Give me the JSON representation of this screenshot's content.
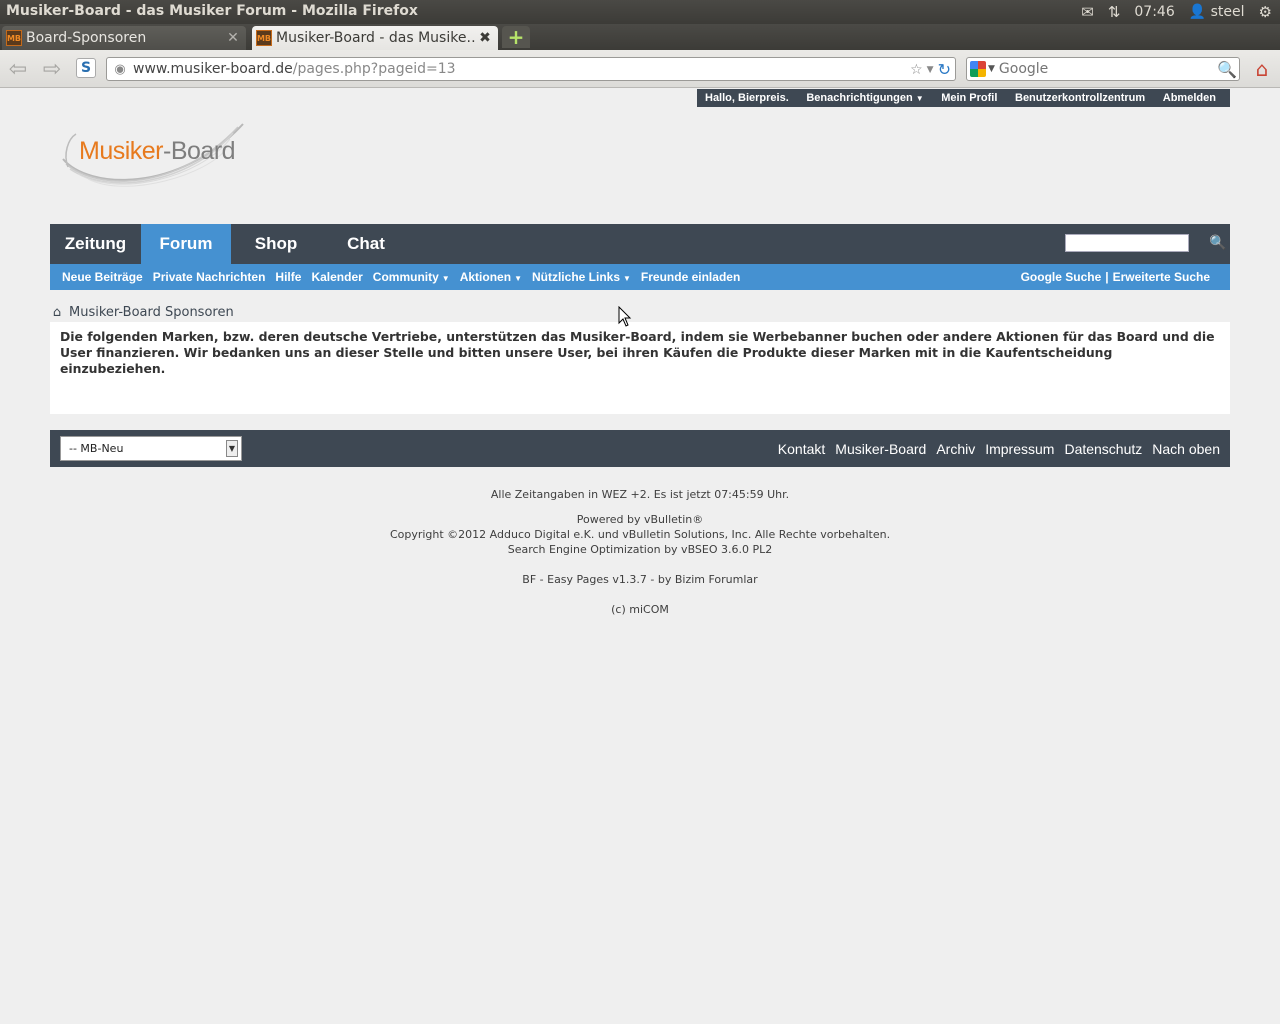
{
  "window": {
    "title": "Musiker-Board - das Musiker Forum - Mozilla Firefox",
    "clock": "07:46",
    "user": "steel"
  },
  "tabs": [
    {
      "label": "Board-Sponsoren",
      "active": false
    },
    {
      "label": "Musiker-Board - das Musike…",
      "active": true
    }
  ],
  "favicon_text": "MB",
  "address": {
    "domain": "www.musiker-board.de",
    "path": "/pages.php?pageid=13"
  },
  "search_box": {
    "placeholder": "Google"
  },
  "userbar": {
    "greeting": "Hallo, Bierpreis.",
    "notifications": "Benachrichtigungen",
    "profile": "Mein Profil",
    "control_panel": "Benutzerkontrollzentrum",
    "logout": "Abmelden"
  },
  "logo": {
    "part1": "Musiker",
    "part2": "-Board"
  },
  "mainnav": {
    "tabs": [
      "Zeitung",
      "Forum",
      "Shop",
      "Chat"
    ],
    "selected": "Forum"
  },
  "subnav": {
    "links": [
      "Neue Beiträge",
      "Private Nachrichten",
      "Hilfe",
      "Kalender",
      "Community",
      "Aktionen",
      "Nützliche Links",
      "Freunde einladen"
    ],
    "google_search": "Google Suche",
    "separator": "|",
    "advanced_search": "Erweiterte Suche"
  },
  "breadcrumb": {
    "current": "Musiker-Board Sponsoren"
  },
  "content": {
    "text": "Die folgenden Marken, bzw. deren deutsche Vertriebe, unterstützen das Musiker-Board, indem sie Werbebanner buchen oder andere Aktionen für das Board und die User finanzieren. Wir bedanken uns an dieser Stelle und bitten unsere User, bei ihren Käufen die Produkte dieser Marken mit in die Kaufentscheidung einzubeziehen."
  },
  "footer": {
    "style_select": "-- MB-Neu",
    "links": [
      "Kontakt",
      "Musiker-Board",
      "Archiv",
      "Impressum",
      "Datenschutz",
      "Nach oben"
    ],
    "timezone": "Alle Zeitangaben in WEZ +2. Es ist jetzt 07:45:59 Uhr.",
    "powered": "Powered by vBulletin®",
    "copyright": "Copyright ©2012 Adduco Digital e.K. und vBulletin Solutions, Inc. Alle Rechte vorbehalten.",
    "seo": "Search Engine Optimization by vBSEO 3.6.0 PL2",
    "easypages": "BF - Easy Pages v1.3.7 - by Bizim Forumlar",
    "micom": "(c) miCOM"
  },
  "colors": {
    "nav_dark": "#3e4853",
    "nav_blue": "#4591d1",
    "logo_orange": "#e77a1e"
  }
}
